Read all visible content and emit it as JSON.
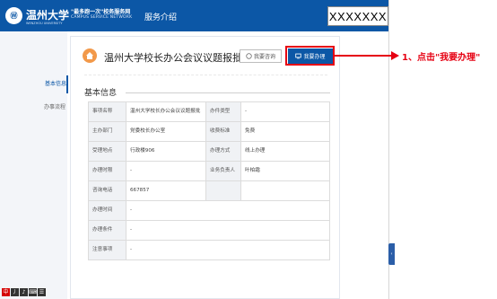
{
  "header": {
    "logo_text": "Ⓦ",
    "university_name": "温州大学",
    "university_sub": "WENZHOU UNIVERSITY",
    "portal_title": "\"最多跑一次\"校务服务网",
    "portal_sub": "CAMPUS SERVICE NETWORK",
    "nav_item": "服务介绍",
    "redacted_user": "XXXXXXX"
  },
  "sidebar": {
    "items": [
      {
        "label": "基本信息"
      },
      {
        "label": "办事流程"
      }
    ]
  },
  "service": {
    "title": "温州大学校长办公会议议题报批",
    "consult_button": "我要咨询",
    "apply_button": "我要办理"
  },
  "basic_info": {
    "section_title": "基本信息",
    "rows": [
      {
        "k1": "事项名称",
        "v1": "温州大学校长办公会议议题报批",
        "k2": "办件类型",
        "v2": "-"
      },
      {
        "k1": "主办部门",
        "v1": "党委校长办公室",
        "k2": "收费标准",
        "v2": "免费"
      },
      {
        "k1": "受理地点",
        "v1": "行政楼906",
        "k2": "办理方式",
        "v2": "线上办理"
      },
      {
        "k1": "办理时限",
        "v1": "-",
        "k2": "业务负责人",
        "v2": "叶柏霜"
      },
      {
        "k1": "咨询电话",
        "v1": "667857",
        "k2": "",
        "v2": ""
      }
    ],
    "wide_rows": [
      {
        "k": "办理时间",
        "v": "-"
      },
      {
        "k": "办理条件",
        "v": "-"
      },
      {
        "k": "注意事项",
        "v": "-"
      }
    ]
  },
  "annotation": {
    "text": "1、点击\"我要办理\"",
    "color": "#e60012"
  },
  "colors": {
    "brand": "#0c57a6",
    "accent_orange": "#f2994a",
    "highlight_red": "#e60012"
  },
  "ime_glyphs": [
    "中",
    "丿",
    "♪",
    "⌨",
    "☰"
  ],
  "floating_tab": "‹"
}
